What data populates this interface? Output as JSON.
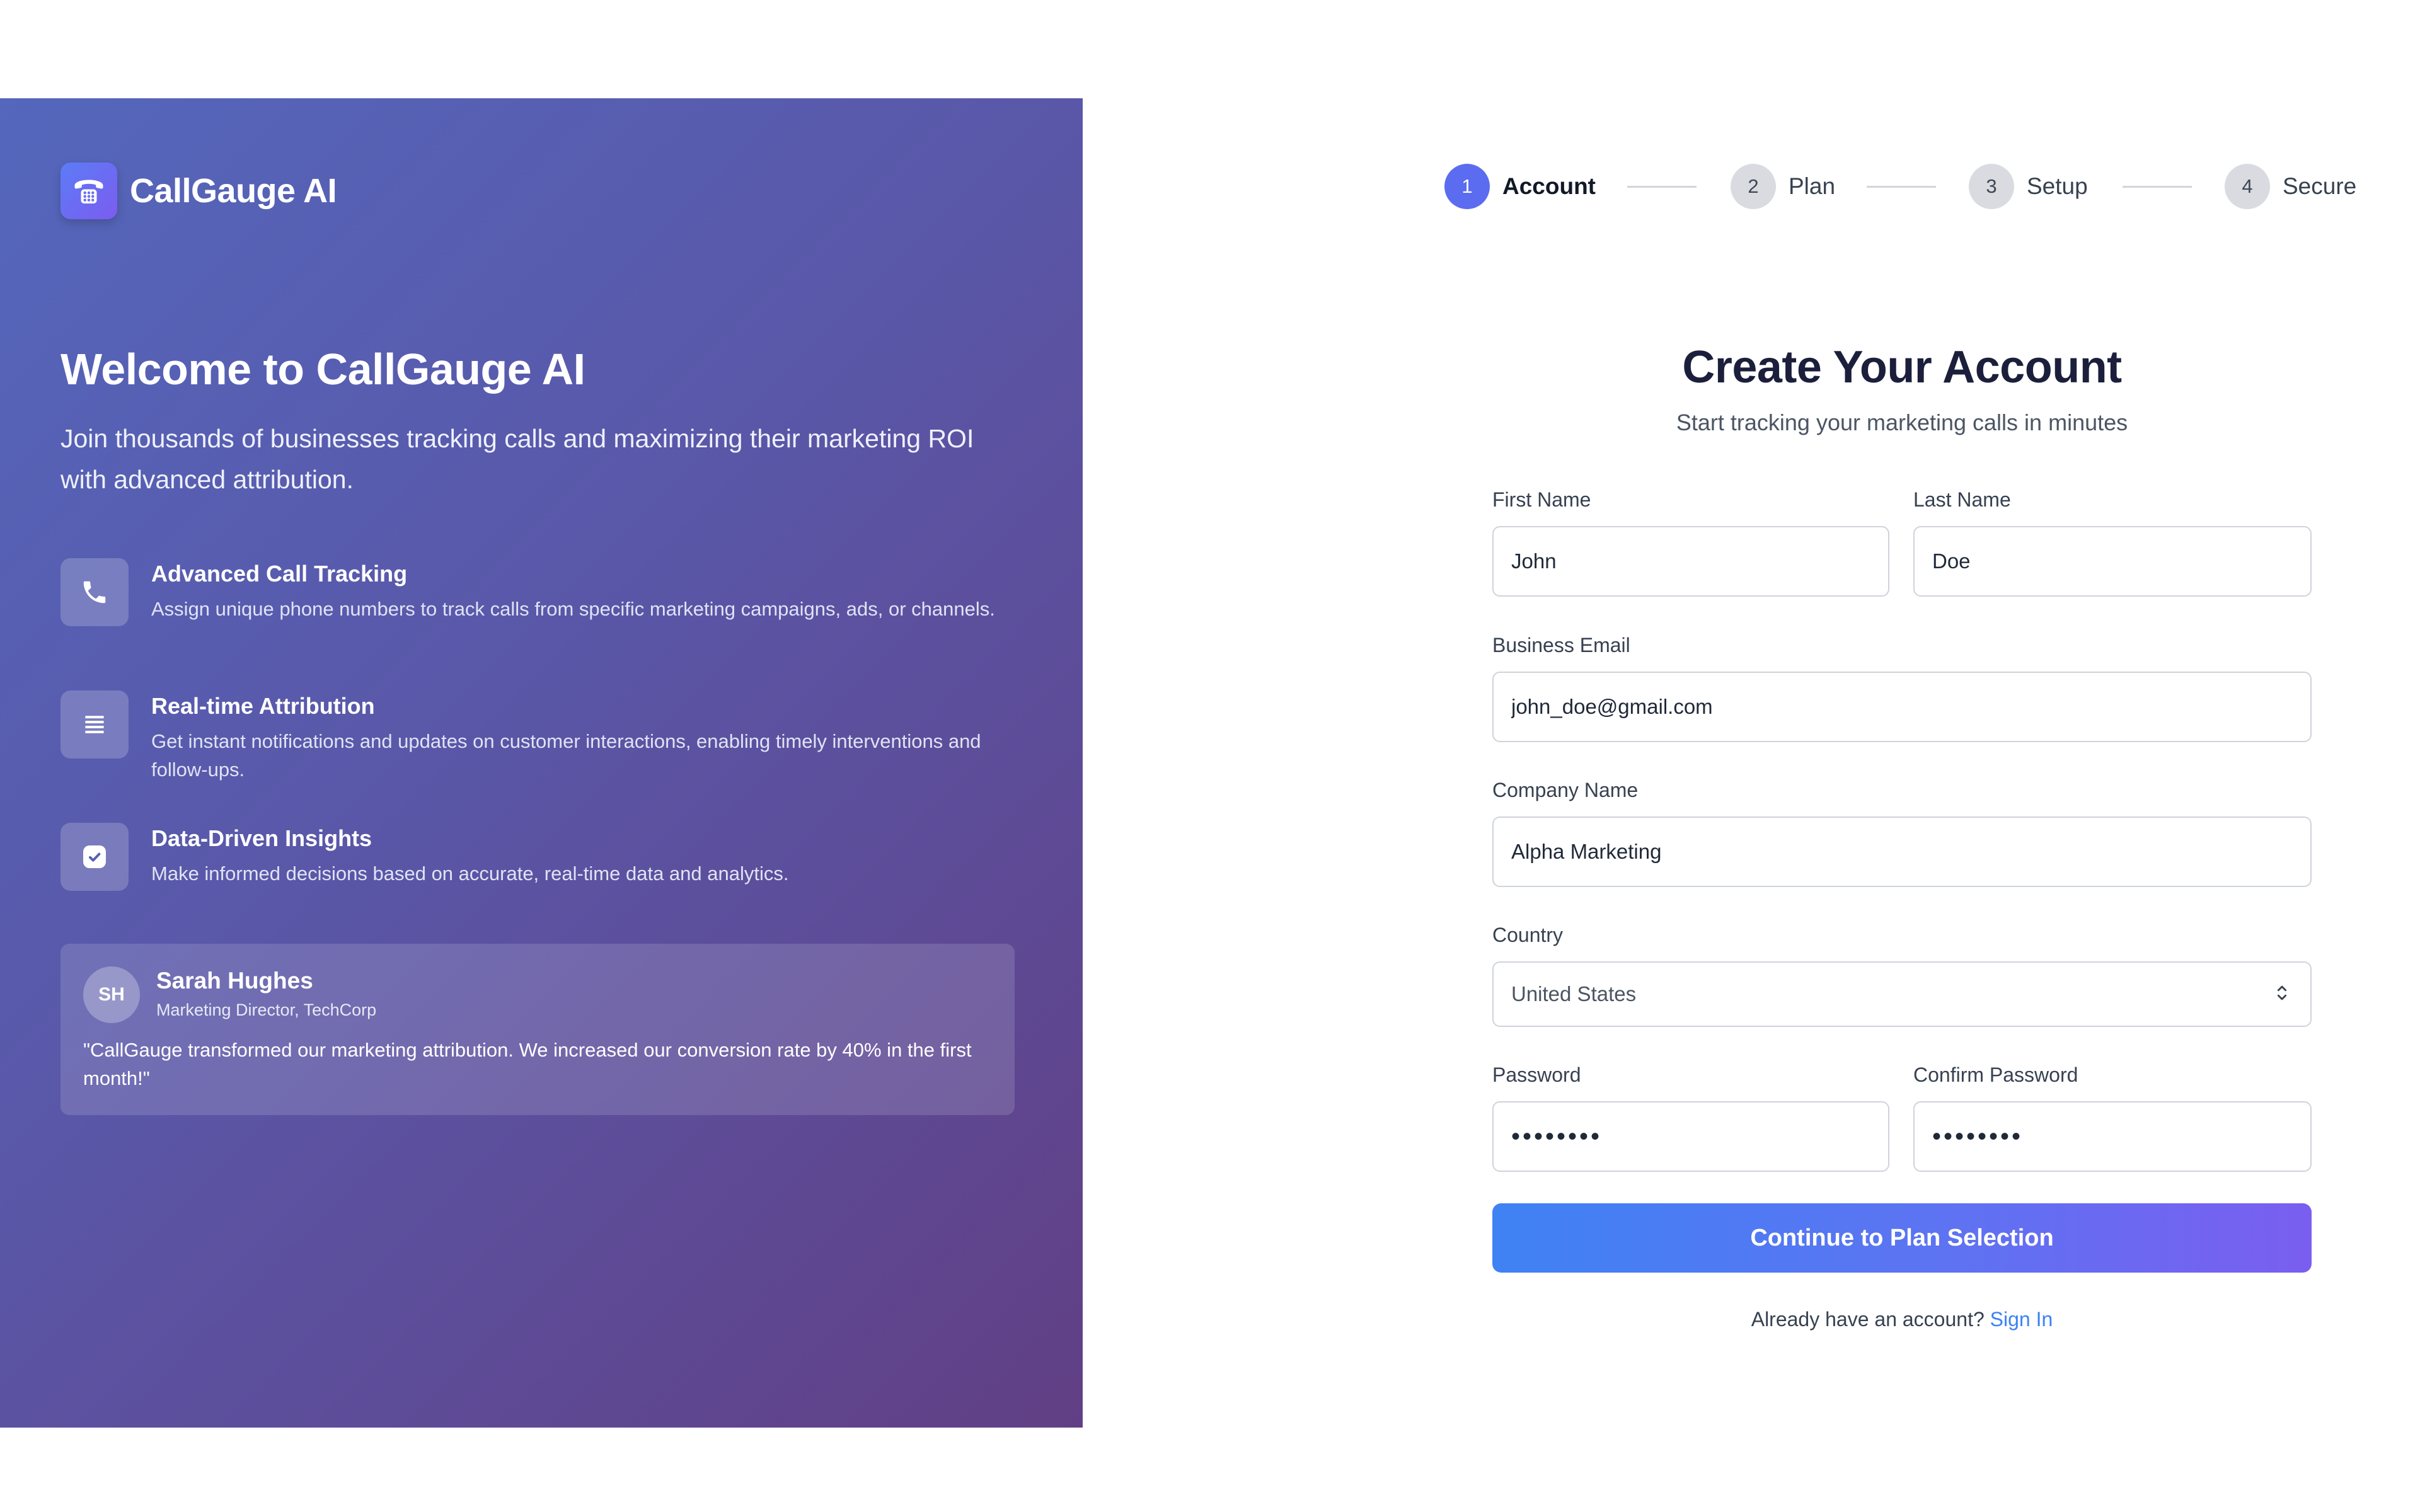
{
  "brand": {
    "name": "CallGauge AI",
    "icon": "rotary-phone-icon"
  },
  "welcome": {
    "title": "Welcome to CallGauge AI",
    "subtitle": "Join thousands of businesses tracking calls and maximizing their marketing ROI with advanced attribution."
  },
  "features": [
    {
      "icon": "phone-icon",
      "title": "Advanced Call Tracking",
      "description": "Assign unique phone numbers to track calls from specific marketing campaigns, ads, or channels."
    },
    {
      "icon": "list-icon",
      "title": "Real-time Attribution",
      "description": "Get instant notifications and updates on customer interactions, enabling timely interventions and follow-ups."
    },
    {
      "icon": "gauge-icon",
      "title": "Data-Driven Insights",
      "description": "Make informed decisions based on accurate, real-time data and analytics."
    }
  ],
  "testimonial": {
    "initials": "SH",
    "name": "Sarah Hughes",
    "role": "Marketing Director, TechCorp",
    "quote": "\"CallGauge transformed our marketing attribution. We increased our conversion rate by 40% in the first month!\""
  },
  "stepper": {
    "steps": [
      {
        "number": "1",
        "label": "Account",
        "active": true
      },
      {
        "number": "2",
        "label": "Plan",
        "active": false
      },
      {
        "number": "3",
        "label": "Setup",
        "active": false
      },
      {
        "number": "4",
        "label": "Secure",
        "active": false
      }
    ]
  },
  "form": {
    "title": "Create Your Account",
    "subtitle": "Start tracking your marketing calls in minutes",
    "first_name": {
      "label": "First Name",
      "value": "John"
    },
    "last_name": {
      "label": "Last Name",
      "value": "Doe"
    },
    "email": {
      "label": "Business Email",
      "value": "john_doe@gmail.com"
    },
    "company": {
      "label": "Company Name",
      "value": "Alpha Marketing"
    },
    "country": {
      "label": "Country",
      "value": "United States"
    },
    "password": {
      "label": "Password",
      "value": "••••••••"
    },
    "confirm_password": {
      "label": "Confirm Password",
      "value": "••••••••"
    },
    "submit_label": "Continue to Plan Selection",
    "signin_prompt": "Already have an account?",
    "signin_link": "Sign In"
  },
  "colors": {
    "accent": "#5b6cf0",
    "panel_start": "#5467bc",
    "panel_end": "#613f85",
    "link": "#3b82f6"
  }
}
